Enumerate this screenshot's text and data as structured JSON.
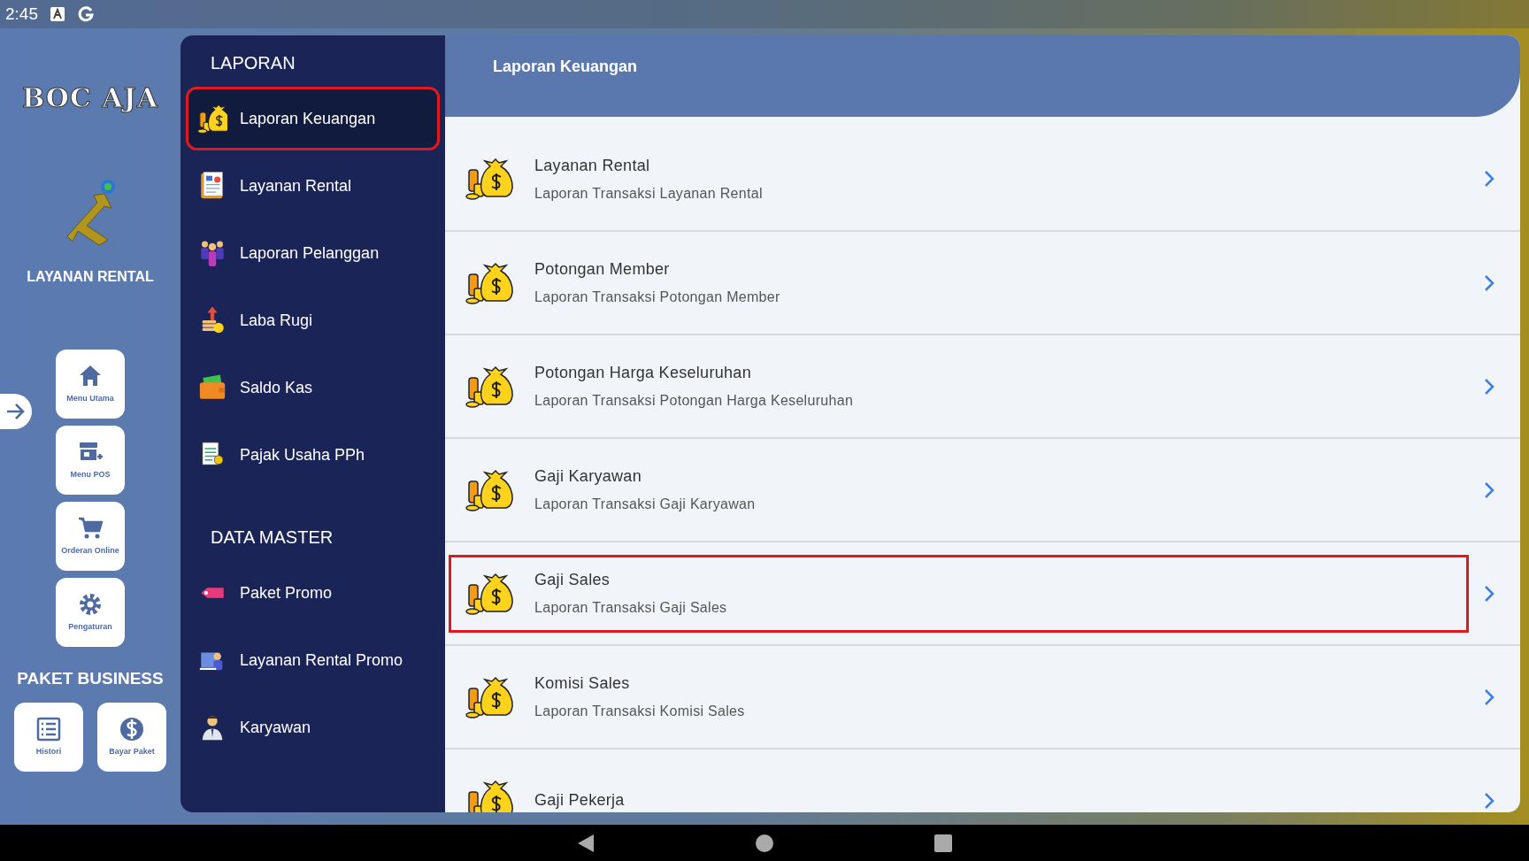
{
  "status_bar": {
    "time": "2:45"
  },
  "rail": {
    "logo": "BOC AJA",
    "app_label": "LAYANAN RENTAL",
    "buttons": [
      {
        "label": "Menu Utama",
        "kind": "home"
      },
      {
        "label": "Menu POS",
        "kind": "pos"
      },
      {
        "label": "Orderan Online",
        "kind": "cart"
      },
      {
        "label": "Pengaturan",
        "kind": "gear"
      }
    ],
    "package_title": "PAKET BUSINESS",
    "package_buttons": [
      {
        "label": "Histori",
        "kind": "list"
      },
      {
        "label": "Bayar Paket",
        "kind": "dollar"
      }
    ]
  },
  "menu": [
    {
      "heading": "LAPORAN",
      "items": [
        {
          "label": "Laporan Keuangan",
          "kind": "moneybag",
          "selected": true,
          "highlighted": true
        },
        {
          "label": "Layanan Rental",
          "kind": "report",
          "selected": false,
          "highlighted": false
        },
        {
          "label": "Laporan Pelanggan",
          "kind": "people",
          "selected": false,
          "highlighted": false
        },
        {
          "label": "Laba Rugi",
          "kind": "profit",
          "selected": false,
          "highlighted": false
        },
        {
          "label": "Saldo Kas",
          "kind": "wallet",
          "selected": false,
          "highlighted": false
        },
        {
          "label": "Pajak Usaha PPh",
          "kind": "tax",
          "selected": false,
          "highlighted": false
        }
      ]
    },
    {
      "heading": "DATA MASTER",
      "items": [
        {
          "label": "Paket Promo",
          "kind": "tag",
          "selected": false,
          "highlighted": false
        },
        {
          "label": "Layanan Rental Promo",
          "kind": "promo",
          "selected": false,
          "highlighted": false
        },
        {
          "label": "Karyawan",
          "kind": "person",
          "selected": false,
          "highlighted": false
        }
      ]
    }
  ],
  "page": {
    "title": "Laporan Keuangan",
    "rows": [
      {
        "title": "Layanan Rental",
        "subtitle": "Laporan Transaksi Layanan Rental",
        "highlighted": false
      },
      {
        "title": "Potongan Member",
        "subtitle": "Laporan Transaksi Potongan Member",
        "highlighted": false
      },
      {
        "title": "Potongan Harga Keseluruhan",
        "subtitle": "Laporan Transaksi Potongan Harga Keseluruhan",
        "highlighted": false
      },
      {
        "title": "Gaji Karyawan",
        "subtitle": "Laporan Transaksi Gaji Karyawan",
        "highlighted": false
      },
      {
        "title": "Gaji Sales",
        "subtitle": "Laporan Transaksi Gaji Sales",
        "highlighted": true
      },
      {
        "title": "Komisi Sales",
        "subtitle": "Laporan Transaksi Komisi Sales",
        "highlighted": false
      },
      {
        "title": "Gaji Pekerja",
        "highlighted": false
      }
    ]
  }
}
